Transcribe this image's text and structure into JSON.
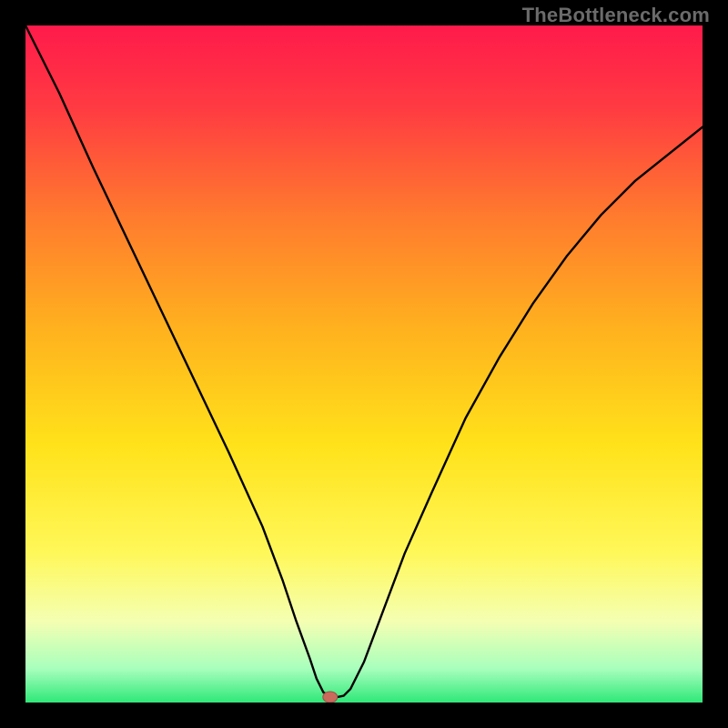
{
  "watermark": "TheBottleneck.com",
  "chart_data": {
    "type": "line",
    "title": "",
    "xlabel": "",
    "ylabel": "",
    "xlim": [
      0,
      100
    ],
    "ylim": [
      0,
      100
    ],
    "grid": false,
    "background_gradient": [
      {
        "offset": 0.0,
        "color": "#ff1a4b"
      },
      {
        "offset": 0.12,
        "color": "#ff3a42"
      },
      {
        "offset": 0.28,
        "color": "#ff7a2e"
      },
      {
        "offset": 0.45,
        "color": "#ffb21e"
      },
      {
        "offset": 0.62,
        "color": "#ffe21a"
      },
      {
        "offset": 0.78,
        "color": "#fff85a"
      },
      {
        "offset": 0.88,
        "color": "#f4ffb2"
      },
      {
        "offset": 0.95,
        "color": "#a8ffbd"
      },
      {
        "offset": 1.0,
        "color": "#2fe879"
      }
    ],
    "series": [
      {
        "name": "bottleneck-curve",
        "x": [
          0,
          5,
          10,
          15,
          20,
          25,
          30,
          35,
          38,
          40,
          42,
          43,
          44,
          45,
          46,
          47,
          48,
          50,
          53,
          56,
          60,
          65,
          70,
          75,
          80,
          85,
          90,
          95,
          100
        ],
        "y": [
          100,
          90,
          79,
          68.5,
          58,
          47.5,
          37,
          26,
          18,
          12,
          6.5,
          3.5,
          1.5,
          0.9,
          0.8,
          1.0,
          2.0,
          6,
          14,
          22,
          31,
          42,
          51,
          59,
          66,
          72,
          77,
          81,
          85
        ]
      }
    ],
    "marker": {
      "x": 45,
      "y": 0.8
    }
  }
}
